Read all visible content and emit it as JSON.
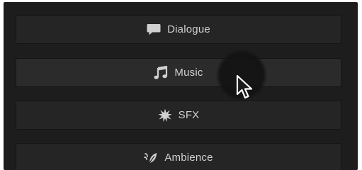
{
  "buttons": [
    {
      "label": "Dialogue",
      "icon": "speech-bubble-icon"
    },
    {
      "label": "Music",
      "icon": "music-note-icon"
    },
    {
      "label": "SFX",
      "icon": "burst-icon"
    },
    {
      "label": "Ambience",
      "icon": "leaf-wind-icon"
    }
  ],
  "colors": {
    "panel": "#1d1d1d",
    "button": "#252525",
    "text": "#d0d0d0"
  }
}
